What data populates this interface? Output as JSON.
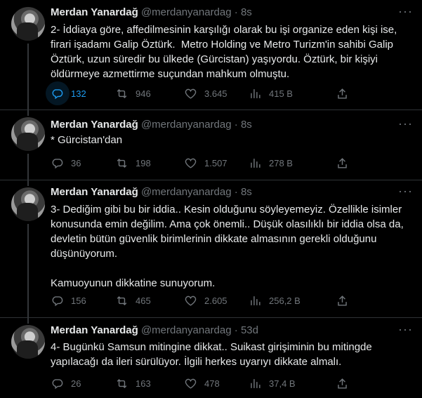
{
  "colors": {
    "background": "#000000",
    "text": "#e7e9ea",
    "muted": "#71767b",
    "accent": "#1d9bf0",
    "border": "#2f3336"
  },
  "author": {
    "name": "Merdan Yanardağ",
    "handle": "@merdanyanardag"
  },
  "tweets": [
    {
      "time": "8s",
      "text": "2- İddiaya göre, affedilmesinin karşılığı olarak bu işi organize eden kişi ise, firari işadamı Galip Öztürk.  Metro Holding ve Metro Turizm'in sahibi Galip Öztürk, uzun süredir bu ülkede (Gürcistan) yaşıyordu. Öztürk, bir kişiyi öldürmeye azmettirme suçundan mahkum olmuştu.",
      "replies": "132",
      "retweets": "946",
      "likes": "3.645",
      "views": "415 B"
    },
    {
      "time": "8s",
      "text": "* Gürcistan'dan",
      "replies": "36",
      "retweets": "198",
      "likes": "1.507",
      "views": "278 B"
    },
    {
      "time": "8s",
      "text": "3- Dediğim gibi bu bir iddia.. Kesin olduğunu söyleyemeyiz. Özellikle isimler konusunda emin değilim. Ama çok önemli.. Düşük olasılıklı bir iddia olsa da, devletin bütün güvenlik birimlerinin dikkate almasının gerekli olduğunu düşünüyorum.\n\nKamuoyunun dikkatine sunuyorum.",
      "replies": "156",
      "retweets": "465",
      "likes": "2.605",
      "views": "256,2 B"
    },
    {
      "time": "53d",
      "text": "4- Bugünkü Samsun mitingine dikkat.. Suikast girişiminin bu mitingde yapılacağı da ileri sürülüyor. İlgili herkes uyarıyı dikkate almalı.",
      "replies": "26",
      "retweets": "163",
      "likes": "478",
      "views": "37,4 B"
    }
  ],
  "icons": {
    "reply": "reply-icon",
    "retweet": "retweet-icon",
    "like": "heart-icon",
    "views": "views-icon",
    "share": "share-icon",
    "more": "more-icon"
  },
  "dot": "·"
}
